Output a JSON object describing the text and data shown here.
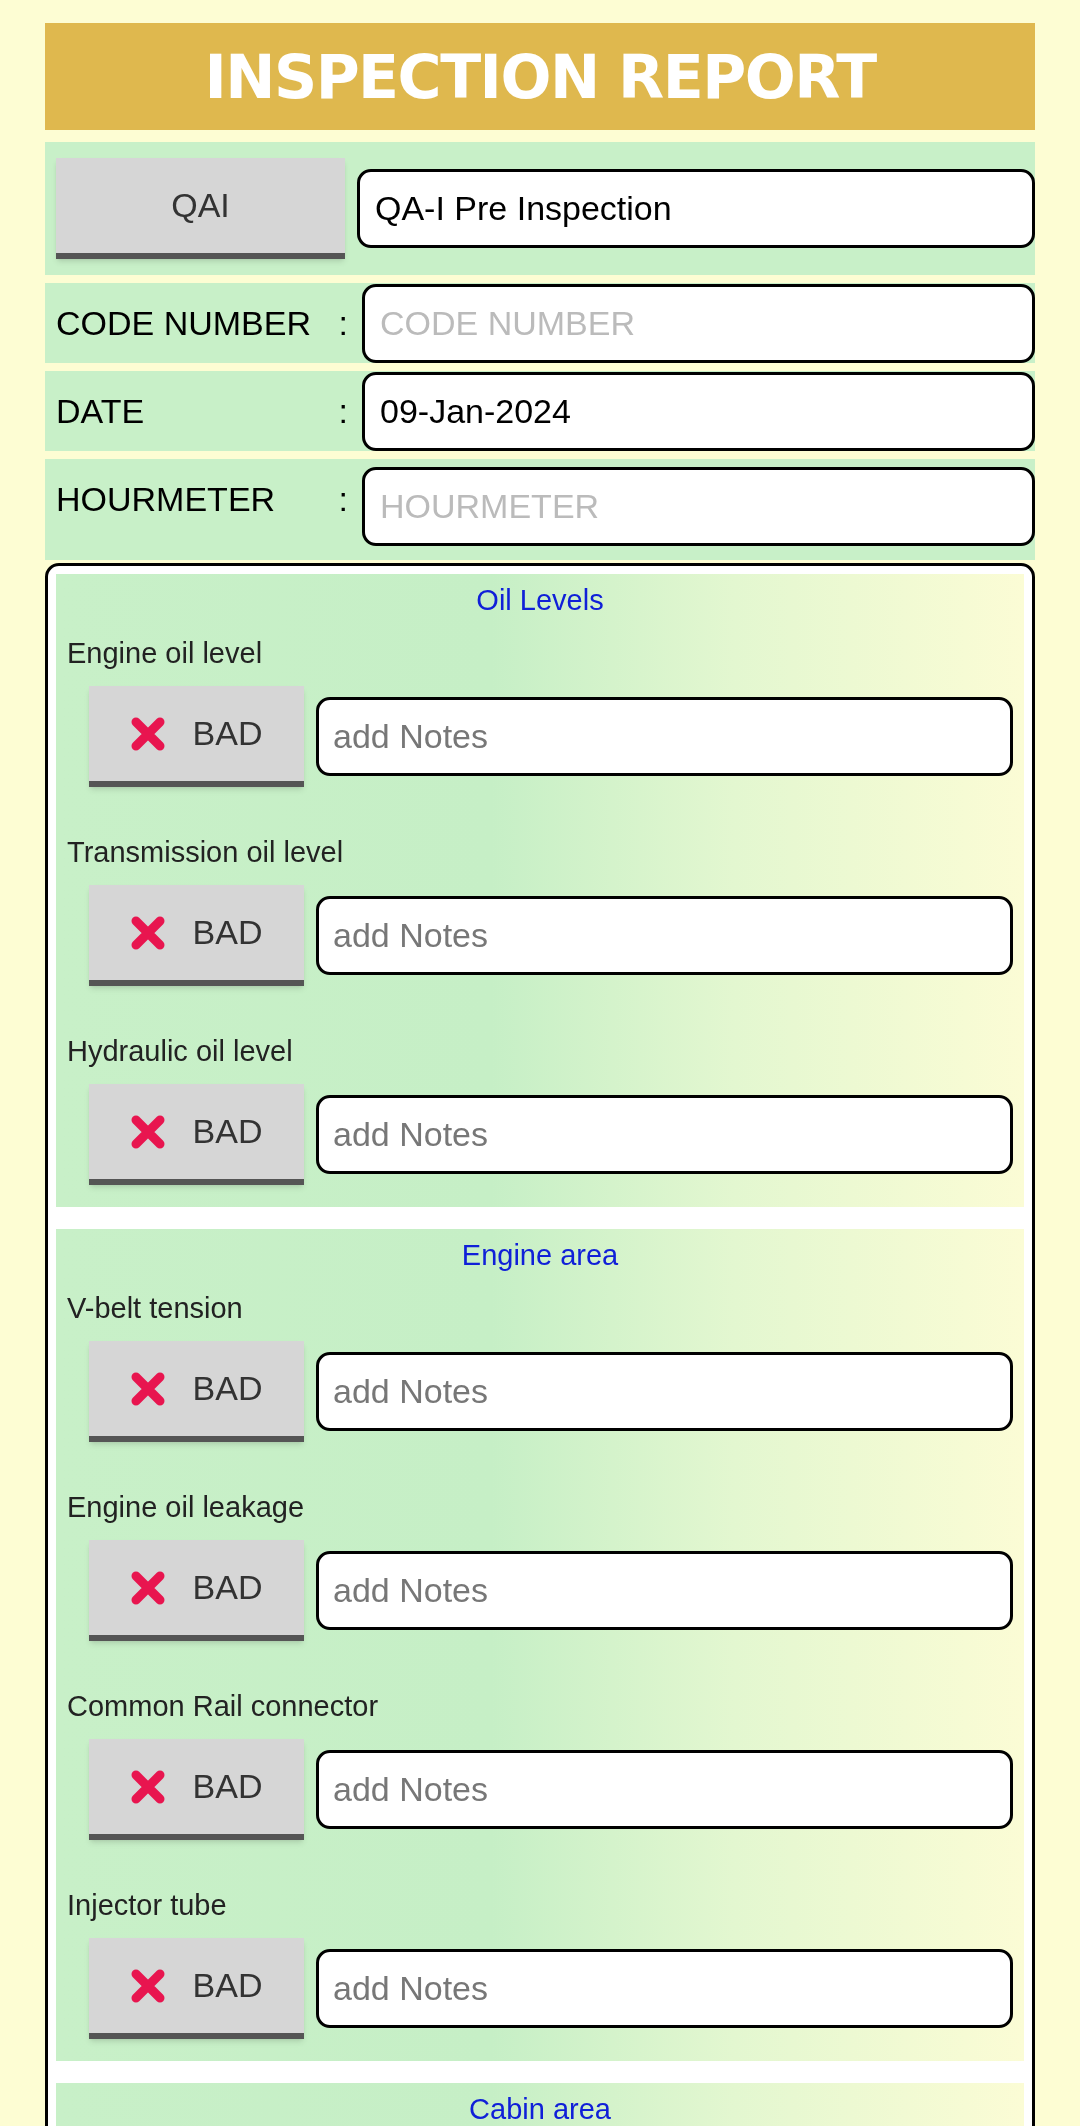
{
  "title": "INSPECTION REPORT",
  "inspection": {
    "button": "QAI",
    "value": "QA-I Pre Inspection"
  },
  "fields": [
    {
      "label": "CODE NUMBER",
      "colon": ":",
      "placeholder": "CODE NUMBER"
    },
    {
      "label": "DATE",
      "colon": ":",
      "value": "09-Jan-2024"
    },
    {
      "label": "HOURMETER",
      "colon": ":",
      "placeholder": "HOURMETER"
    }
  ],
  "sections": [
    {
      "title": "Oil Levels",
      "items": [
        {
          "label": "Engine oil level",
          "kind": "bad",
          "status_label": "BAD",
          "notes_placeholder": "add Notes"
        },
        {
          "label": "Transmission oil level",
          "kind": "bad",
          "status_label": "BAD",
          "notes_placeholder": "add Notes"
        },
        {
          "label": "Hydraulic oil level",
          "kind": "bad",
          "status_label": "BAD",
          "notes_placeholder": "add Notes"
        }
      ]
    },
    {
      "title": "Engine area",
      "items": [
        {
          "label": "V-belt tension",
          "kind": "bad",
          "status_label": "BAD",
          "notes_placeholder": "add Notes"
        },
        {
          "label": "Engine oil leakage",
          "kind": "bad",
          "status_label": "BAD",
          "notes_placeholder": "add Notes"
        },
        {
          "label": "Common Rail connector",
          "kind": "bad",
          "status_label": "BAD",
          "notes_placeholder": "add Notes"
        },
        {
          "label": "Injector tube",
          "kind": "bad",
          "status_label": "BAD",
          "notes_placeholder": "add Notes"
        }
      ]
    },
    {
      "title": "Cabin area"
    }
  ]
}
